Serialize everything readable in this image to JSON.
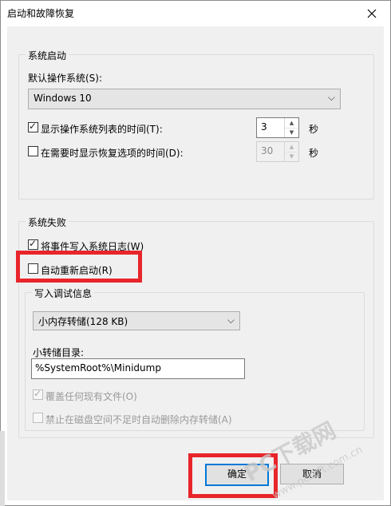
{
  "window": {
    "title": "启动和故障恢复"
  },
  "system_startup": {
    "group_title": "系统启动",
    "default_os_label": "默认操作系统(S):",
    "default_os_value": "Windows 10",
    "show_os_list_label": "显示操作系统列表的时间(T):",
    "show_os_list_checked": true,
    "show_os_list_value": "3",
    "show_os_list_unit": "秒",
    "show_recovery_label": "在需要时显示恢复选项的时间(D):",
    "show_recovery_checked": false,
    "show_recovery_value": "30",
    "show_recovery_unit": "秒"
  },
  "system_failure": {
    "group_title": "系统失败",
    "write_event_label": "将事件写入系统日志(W)",
    "write_event_checked": true,
    "auto_restart_label": "自动重新启动(R)",
    "auto_restart_checked": false,
    "debug_info": {
      "group_title": "写入调试信息",
      "dump_type_value": "小内存转储(128 KB)",
      "dump_dir_label": "小转储目录:",
      "dump_dir_value": "%SystemRoot%\\Minidump",
      "overwrite_label": "覆盖任何现有文件(O)",
      "overwrite_checked": true,
      "disable_auto_delete_label": "禁止在磁盘空间不足时自动删除内存转储(A)",
      "disable_auto_delete_checked": false
    }
  },
  "buttons": {
    "ok": "确定",
    "cancel": "取消"
  },
  "watermark": {
    "text1": "PC下载网",
    "text2": "www.pcsoft.com.cn"
  },
  "colors": {
    "highlight_box": "#e8252b",
    "default_button_border": "#0078d7",
    "dialog_bg": "#f0f0f0"
  }
}
